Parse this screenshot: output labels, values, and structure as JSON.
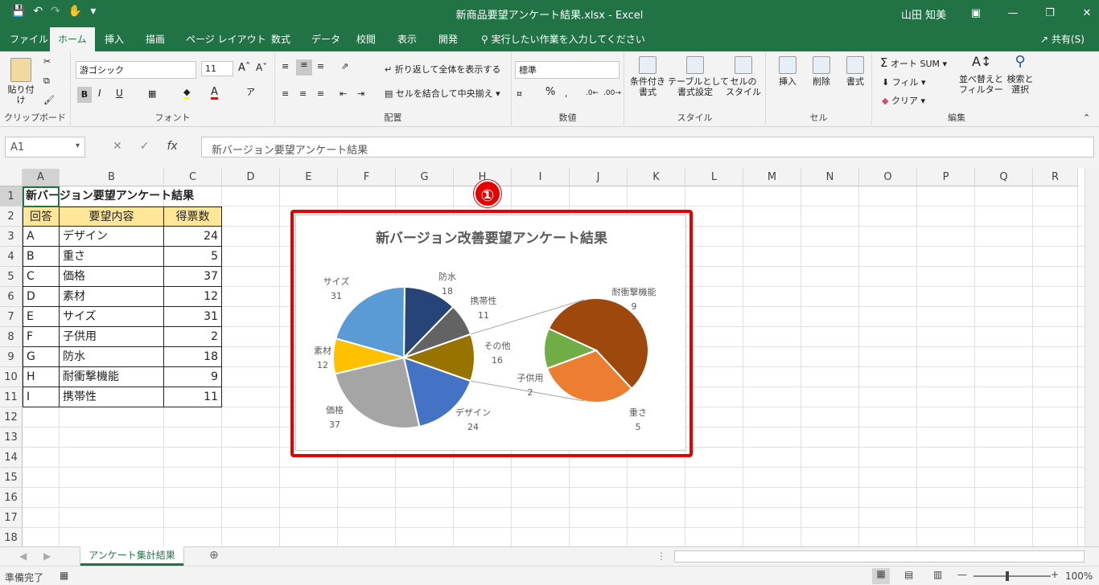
{
  "window": {
    "title": "新商品要望アンケート結果.xlsx - Excel",
    "user": "山田 知美",
    "qat_icons": [
      "save-icon",
      "undo-icon",
      "redo-icon",
      "touch-mode-icon",
      "customize-icon"
    ]
  },
  "tabs": [
    "ファイル",
    "ホーム",
    "挿入",
    "描画",
    "ページ レイアウト",
    "数式",
    "データ",
    "校閲",
    "表示",
    "開発"
  ],
  "tell_me": "実行したい作業を入力してください",
  "share": "共有(S)",
  "ribbon": {
    "clipboard": {
      "paste": "貼り付け",
      "label": "クリップボード"
    },
    "font": {
      "name": "游ゴシック",
      "size": "11",
      "bold": "B",
      "italic": "I",
      "underline": "U",
      "label": "フォント"
    },
    "alignment": {
      "wrap": "折り返して全体を表示する",
      "merge": "セルを結合して中央揃え",
      "label": "配置"
    },
    "number": {
      "format": "標準",
      "percent": "%",
      "label": "数値"
    },
    "styles": {
      "conditional": "条件付き\n書式",
      "table": "テーブルとして\n書式設定",
      "cell": "セルの\nスタイル",
      "label": "スタイル"
    },
    "cells": {
      "insert": "挿入",
      "delete": "削除",
      "format": "書式",
      "label": "セル"
    },
    "editing": {
      "autosum": "オート SUM",
      "fill": "フィル",
      "clear": "クリア",
      "sort": "並べ替えと\nフィルター",
      "find": "検索と\n選択",
      "label": "編集"
    }
  },
  "formula_bar": {
    "name_box": "A1",
    "value": "新バージョン要望アンケート結果"
  },
  "columns": [
    "A",
    "B",
    "C",
    "D",
    "E",
    "F",
    "G",
    "H",
    "I",
    "J",
    "K",
    "L",
    "M",
    "N",
    "O",
    "P",
    "Q",
    "R"
  ],
  "rows": [
    "1",
    "2",
    "3",
    "4",
    "5",
    "6",
    "7",
    "8",
    "9",
    "10",
    "11",
    "12",
    "13",
    "14",
    "15",
    "16",
    "17",
    "18"
  ],
  "sheet": {
    "title": "新バージョン要望アンケート結果",
    "headers": [
      "回答",
      "要望内容",
      "得票数"
    ],
    "rows": [
      [
        "A",
        "デザイン",
        "24"
      ],
      [
        "B",
        "重さ",
        "5"
      ],
      [
        "C",
        "価格",
        "37"
      ],
      [
        "D",
        "素材",
        "12"
      ],
      [
        "E",
        "サイズ",
        "31"
      ],
      [
        "F",
        "子供用",
        "2"
      ],
      [
        "G",
        "防水",
        "18"
      ],
      [
        "H",
        "耐衝撃機能",
        "9"
      ],
      [
        "I",
        "携帯性",
        "11"
      ]
    ]
  },
  "callout": "①",
  "chart_data": {
    "type": "pie",
    "title": "新バージョン改善要望アンケート結果",
    "subtype": "pie-of-pie",
    "main_pie": [
      {
        "label": "防水",
        "value": 18,
        "color": "#264478"
      },
      {
        "label": "携帯性",
        "value": 11,
        "color": "#636363"
      },
      {
        "label": "その他",
        "value": 16,
        "color": "#997300"
      },
      {
        "label": "デザイン",
        "value": 24,
        "color": "#4472c4"
      },
      {
        "label": "価格",
        "value": 37,
        "color": "#a5a5a5"
      },
      {
        "label": "素材",
        "value": 12,
        "color": "#ffc000"
      },
      {
        "label": "サイズ",
        "value": 31,
        "color": "#5b9bd5"
      }
    ],
    "secondary_pie": [
      {
        "label": "耐衝撃機能",
        "value": 9,
        "color": "#9e480e"
      },
      {
        "label": "重さ",
        "value": 5,
        "color": "#ed7d31"
      },
      {
        "label": "子供用",
        "value": 2,
        "color": "#70ad47"
      }
    ]
  },
  "sheet_tab": "アンケート集計結果",
  "status": {
    "ready": "準備完了",
    "zoom": "100%"
  }
}
